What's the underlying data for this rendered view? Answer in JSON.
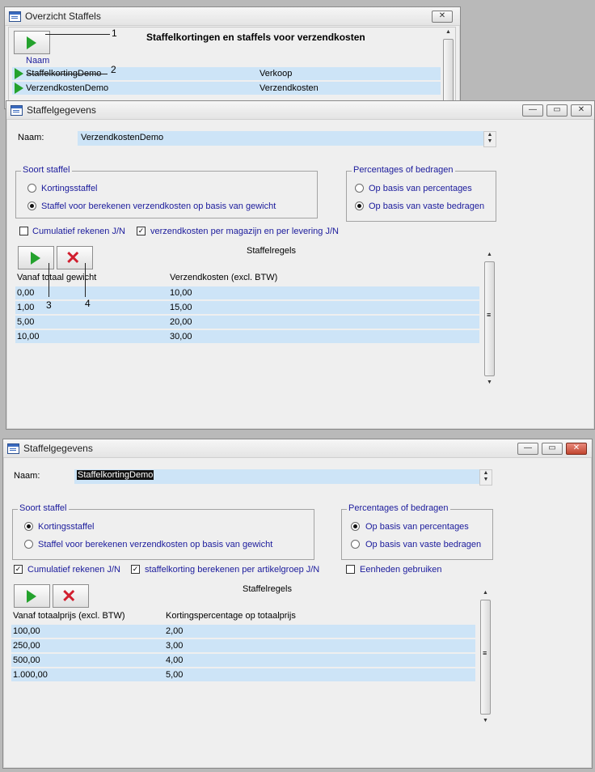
{
  "overview": {
    "title": "Overzicht Staffels",
    "close_glyph": "✕",
    "heading": "Staffelkortingen en staffels voor verzendkosten",
    "col_name": "Naam",
    "rows": [
      {
        "name": "StaffelkortingDemo",
        "type": "Verkoop"
      },
      {
        "name": "VerzendkostenDemo",
        "type": "Verzendkosten"
      }
    ],
    "callouts": [
      "1",
      "2"
    ]
  },
  "win_a": {
    "title": "Staffelgegevens",
    "min_glyph": "—",
    "max_glyph": "▭",
    "close_glyph": "✕",
    "naam_label": "Naam:",
    "naam_value": "VerzendkostenDemo",
    "soort_title": "Soort staffel",
    "soort_opt1": "Kortingsstaffel",
    "soort_opt2": "Staffel voor berekenen verzendkosten op basis van gewicht",
    "soort_selected": 2,
    "perc_title": "Percentages of bedragen",
    "perc_opt1": "Op basis van percentages",
    "perc_opt2": "Op basis van vaste bedragen",
    "perc_selected": 2,
    "chk1_label": "Cumulatief rekenen J/N",
    "chk1_checked": false,
    "chk2_label": "verzendkosten per magazijn en per levering  J/N",
    "chk2_checked": true,
    "regels_title": "Staffelregels",
    "col1": "Vanaf totaal gewicht",
    "col2": "Verzendkosten (excl. BTW)",
    "rows": [
      {
        "a": "0,00",
        "b": "10,00"
      },
      {
        "a": "1,00",
        "b": "15,00"
      },
      {
        "a": "5,00",
        "b": "20,00"
      },
      {
        "a": "10,00",
        "b": "30,00"
      }
    ],
    "callouts": [
      "3",
      "4"
    ]
  },
  "win_b": {
    "title": "Staffelgegevens",
    "min_glyph": "—",
    "max_glyph": "▭",
    "close_glyph": "✕",
    "naam_label": "Naam:",
    "naam_value": "StaffelkortingDemo",
    "soort_title": "Soort staffel",
    "soort_opt1": "Kortingsstaffel",
    "soort_opt2": "Staffel voor berekenen verzendkosten op basis van gewicht",
    "soort_selected": 1,
    "perc_title": "Percentages of bedragen",
    "perc_opt1": "Op basis van percentages",
    "perc_opt2": "Op basis van vaste bedragen",
    "perc_selected": 1,
    "chk1_label": "Cumulatief rekenen J/N",
    "chk1_checked": true,
    "chk2_label": "staffelkorting berekenen per artikelgroep J/N",
    "chk2_checked": true,
    "chk3_label": "Eenheden gebruiken",
    "chk3_checked": false,
    "regels_title": "Staffelregels",
    "col1": "Vanaf totaalprijs (excl. BTW)",
    "col2": "Kortingspercentage op totaalprijs",
    "rows": [
      {
        "a": "100,00",
        "b": "2,00"
      },
      {
        "a": "250,00",
        "b": "3,00"
      },
      {
        "a": "500,00",
        "b": "4,00"
      },
      {
        "a": "1.000,00",
        "b": "5,00"
      }
    ]
  },
  "icons": {
    "checkmark": "✓",
    "up_arrow": "▲",
    "down_arrow": "▼",
    "grip": "≡",
    "x": "✕"
  }
}
